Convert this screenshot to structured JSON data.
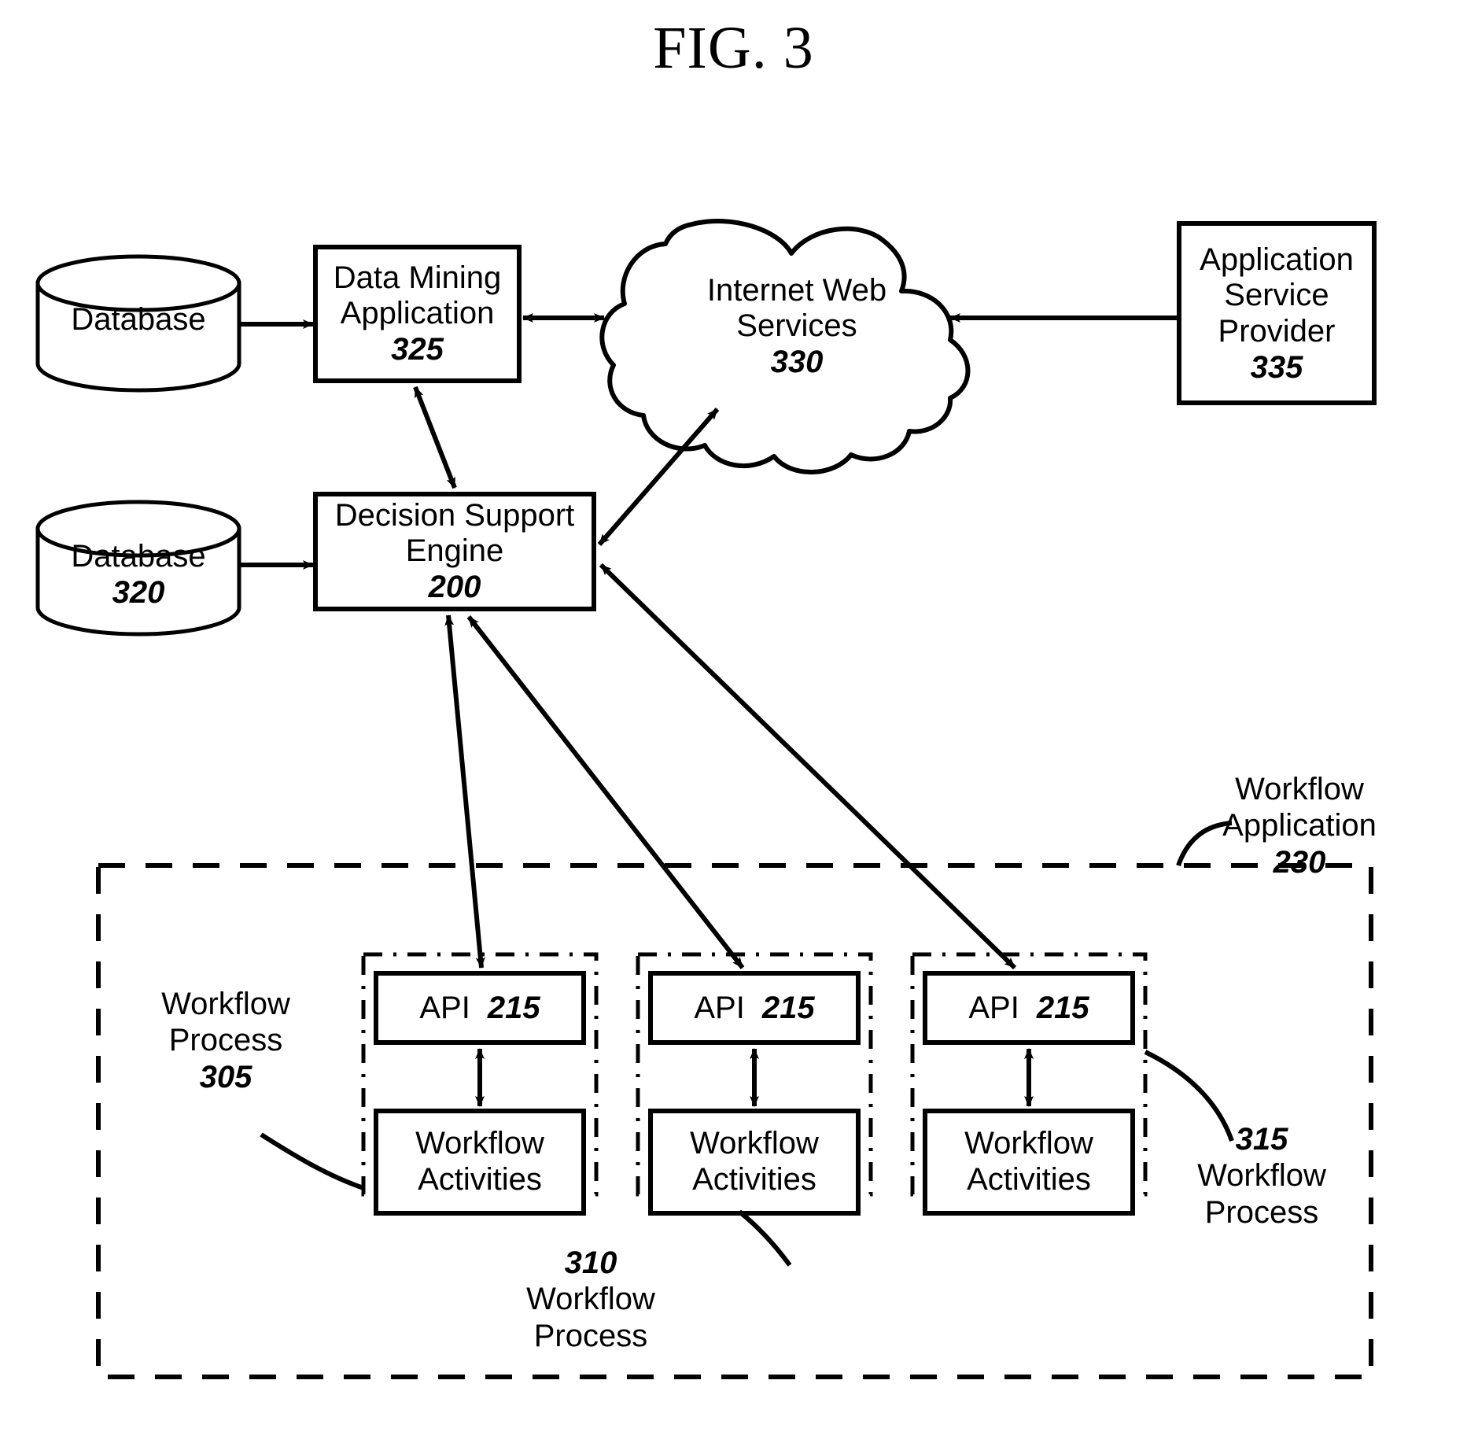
{
  "figure": {
    "title": "FIG. 3"
  },
  "nodes": {
    "database_top": {
      "label": "Database",
      "ref": ""
    },
    "database_bottom": {
      "label": "Database",
      "ref": "320"
    },
    "data_mining": {
      "line1": "Data Mining",
      "line2": "Application",
      "ref": "325"
    },
    "internet_cloud": {
      "line1": "Internet Web",
      "line2": "Services",
      "ref": "330"
    },
    "asp": {
      "line1": "Application",
      "line2": "Service",
      "line3": "Provider",
      "ref": "335"
    },
    "decision_engine": {
      "line1": "Decision Support",
      "line2": "Engine",
      "ref": "200"
    },
    "api_1": {
      "label": "API",
      "ref": "215"
    },
    "api_2": {
      "label": "API",
      "ref": "215"
    },
    "api_3": {
      "label": "API",
      "ref": "215"
    },
    "activities_1": {
      "line1": "Workflow",
      "line2": "Activities"
    },
    "activities_2": {
      "line1": "Workflow",
      "line2": "Activities"
    },
    "activities_3": {
      "line1": "Workflow",
      "line2": "Activities"
    }
  },
  "annotations": {
    "workflow_application": {
      "line1": "Workflow",
      "line2": "Application",
      "ref": "230"
    },
    "workflow_process_305": {
      "line1": "Workflow",
      "line2": "Process",
      "ref": "305"
    },
    "workflow_process_310": {
      "ref": "310",
      "line1": "Workflow",
      "line2": "Process"
    },
    "workflow_process_315": {
      "ref": "315",
      "line1": "Workflow",
      "line2": "Process"
    }
  },
  "style": {
    "stroke": "#000000",
    "fill": "#ffffff",
    "background": "#ffffff"
  }
}
